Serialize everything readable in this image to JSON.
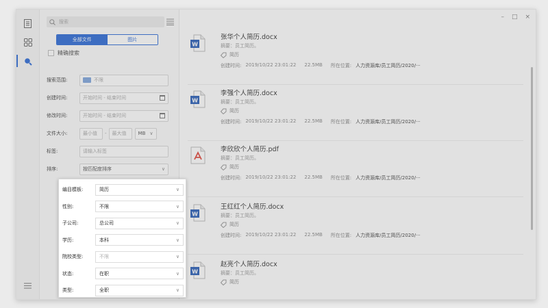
{
  "window_controls": {
    "minimize": "–",
    "maximize": "□",
    "close": "×"
  },
  "search": {
    "placeholder": "搜索"
  },
  "scope_tabs": {
    "all_files": "全部文件",
    "images": "图片"
  },
  "exact_search_label": "精确搜索",
  "filters": {
    "range": {
      "label": "搜索范围:",
      "value": "不限"
    },
    "created": {
      "label": "创建时间:",
      "value": "开始时间 - 结束时间"
    },
    "modified": {
      "label": "修改时间:",
      "value": "开始时间 - 结束时间"
    },
    "size": {
      "label": "文件大小:",
      "min": "最小值",
      "sep": "-",
      "max": "最大值",
      "unit": "MB"
    },
    "tags": {
      "label": "标签:",
      "placeholder": "请输入标签"
    },
    "sort": {
      "label": "排序:",
      "value": "按匹配度排序"
    }
  },
  "popup": {
    "rows": [
      {
        "label": "编目模板:",
        "value": "简历",
        "placeholder": false
      },
      {
        "label": "性别:",
        "value": "不限",
        "placeholder": false
      },
      {
        "label": "子公司:",
        "value": "总公司",
        "placeholder": false
      },
      {
        "label": "学历:",
        "value": "本科",
        "placeholder": false
      },
      {
        "label": "院校类型:",
        "value": "不限",
        "placeholder": true
      },
      {
        "label": "状态:",
        "value": "在职",
        "placeholder": false
      },
      {
        "label": "类型:",
        "value": "全职",
        "placeholder": false
      }
    ]
  },
  "results": [
    {
      "icon": "word-doc-icon",
      "name": "张华个人简历.docx",
      "summary": "摘要：员工简历。",
      "tag": "简历",
      "created_label": "创建时间:",
      "created": "2019/10/22 23:01:22",
      "size": "22.5MB",
      "location_label": "所在位置:",
      "location": "人力资源库/员工简历/2020/···"
    },
    {
      "icon": "word-doc-icon",
      "name": "李强个人简历.docx",
      "summary": "摘要：员工简历。",
      "tag": "简历",
      "created_label": "创建时间:",
      "created": "2019/10/22 23:01:22",
      "size": "22.5MB",
      "location_label": "所在位置:",
      "location": "人力资源库/员工简历/2020/···"
    },
    {
      "icon": "pdf-doc-icon",
      "name": "李欣欣个人简历.pdf",
      "summary": "摘要：员工简历。",
      "tag": "简历",
      "created_label": "创建时间:",
      "created": "2019/10/22 23:01:22",
      "size": "22.5MB",
      "location_label": "所在位置:",
      "location": "人力资源库/员工简历/2020/···"
    },
    {
      "icon": "word-doc-icon",
      "name": "王红红个人简历.docx",
      "summary": "摘要：员工简历。",
      "tag": "简历",
      "created_label": "创建时间:",
      "created": "2019/10/22 23:01:22",
      "size": "22.5MB",
      "location_label": "所在位置:",
      "location": "人力资源库/员工简历/2020/···"
    },
    {
      "icon": "word-doc-icon",
      "name": "赵亮个人简历.docx",
      "summary": "摘要：员工简历。",
      "tag": "简历"
    }
  ],
  "colors": {
    "accent": "#2d6bd6",
    "word": "#2b5fb8",
    "pdf": "#e0473c"
  }
}
